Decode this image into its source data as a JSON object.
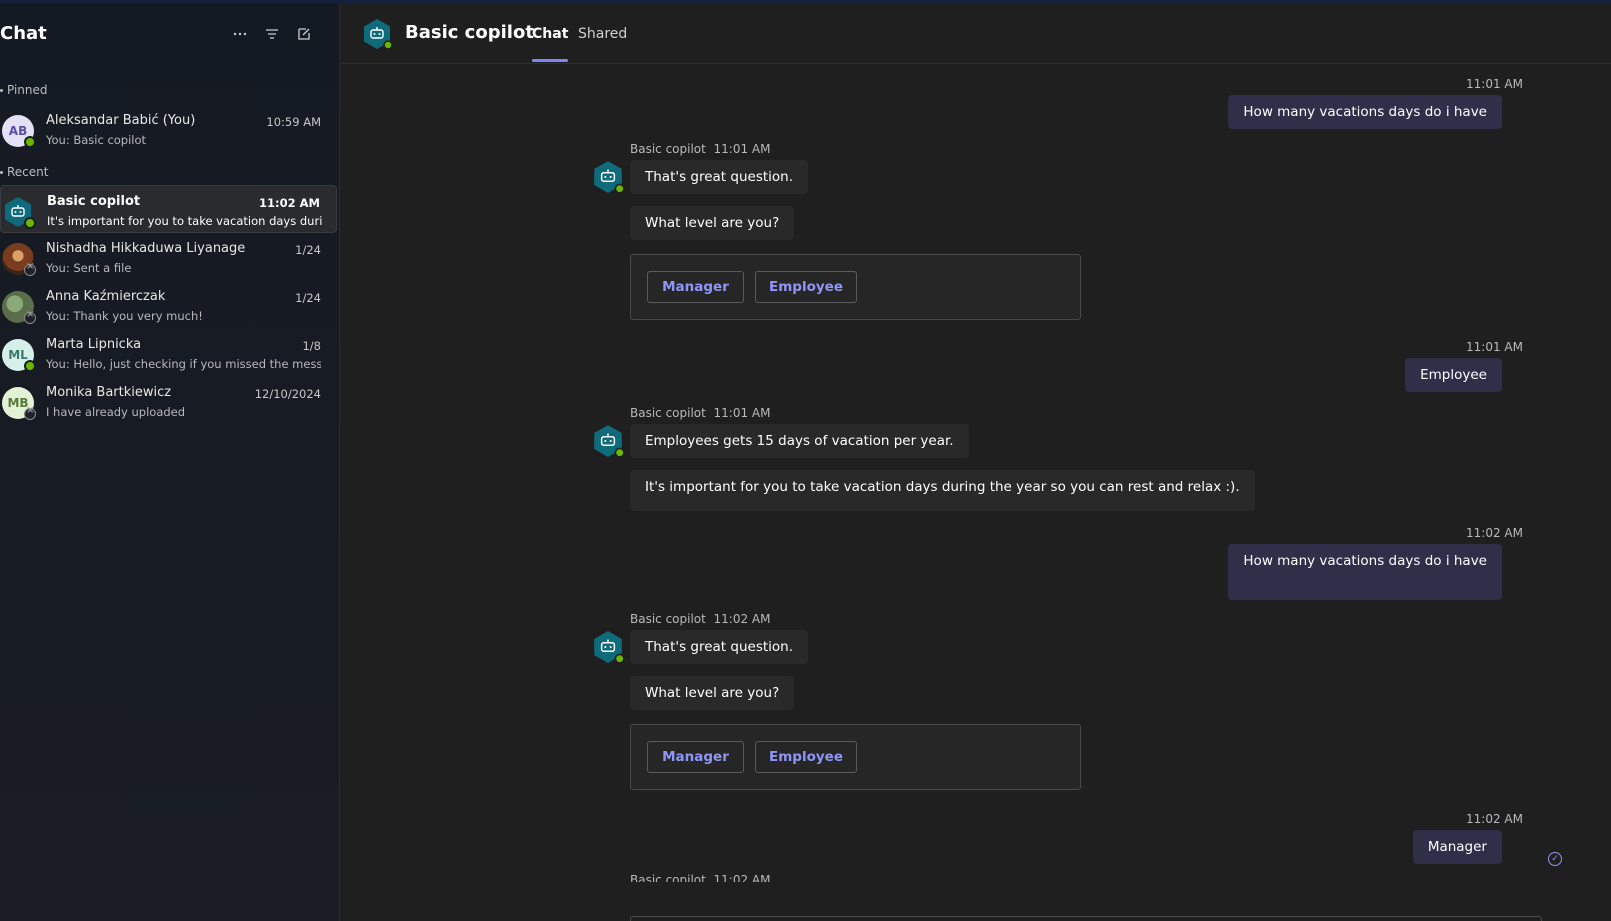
{
  "sidebar": {
    "title": "Chat",
    "icons": [
      "more-icon",
      "filter-icon",
      "new-chat-icon"
    ],
    "pinned_label": "Pinned",
    "recent_label": "Recent",
    "pinned": [
      {
        "initials": "AB",
        "name": "Aleksandar Babić (You)",
        "time": "10:59 AM",
        "preview": "You: Basic copilot",
        "status": "available"
      }
    ],
    "recent": [
      {
        "name": "Basic copilot",
        "time": "11:02 AM",
        "preview": "It's important for you to take vacation days during...",
        "status": "available",
        "active": true
      },
      {
        "name": "Nishadha Hikkaduwa Liyanage",
        "time": "1/24",
        "preview": "You: Sent a file",
        "status": "offline"
      },
      {
        "name": "Anna Kaźmierczak",
        "time": "1/24",
        "preview": "You: Thank you very much!",
        "status": "offline"
      },
      {
        "initials": "ML",
        "name": "Marta Lipnicka",
        "time": "1/8",
        "preview": "You: Hello, just checking if you missed the message.",
        "status": "available"
      },
      {
        "initials": "MB",
        "name": "Monika Bartkiewicz",
        "time": "12/10/2024",
        "preview": "I have already uploaded",
        "status": "offline"
      }
    ]
  },
  "header": {
    "title": "Basic copilot",
    "tabs": [
      "Chat",
      "Shared"
    ]
  },
  "messages": {
    "m1": {
      "time": "11:01 AM",
      "text": "How many vacations days do i have"
    },
    "b1": {
      "sender": "Basic copilot",
      "time": "11:01 AM",
      "lines": [
        "That's great question.",
        "What level are you?"
      ],
      "buttons": [
        "Manager",
        "Employee"
      ]
    },
    "m2": {
      "time": "11:01 AM",
      "text": "Employee"
    },
    "b2": {
      "sender": "Basic copilot",
      "time": "11:01 AM",
      "lines": [
        "Employees gets 15 days of vacation per year.",
        "It's important for you to take vacation days during the year so you can rest and relax :)."
      ]
    },
    "m3": {
      "time": "11:02 AM",
      "text": "How many vacations days do i have"
    },
    "b3": {
      "sender": "Basic copilot",
      "time": "11:02 AM",
      "lines": [
        "That's great question.",
        "What level are you?"
      ],
      "buttons": [
        "Manager",
        "Employee"
      ]
    },
    "m4": {
      "time": "11:02 AM",
      "text": "Manager"
    },
    "b4": {
      "sender": "Basic copilot",
      "time": "11:02 AM"
    }
  },
  "colors": {
    "accent": "#7f85f5",
    "outgoing_bubble": "#2f2f4a",
    "incoming_bubble": "#292929",
    "bot_avatar": "#0f6b7a",
    "presence_available": "#6bb700"
  }
}
